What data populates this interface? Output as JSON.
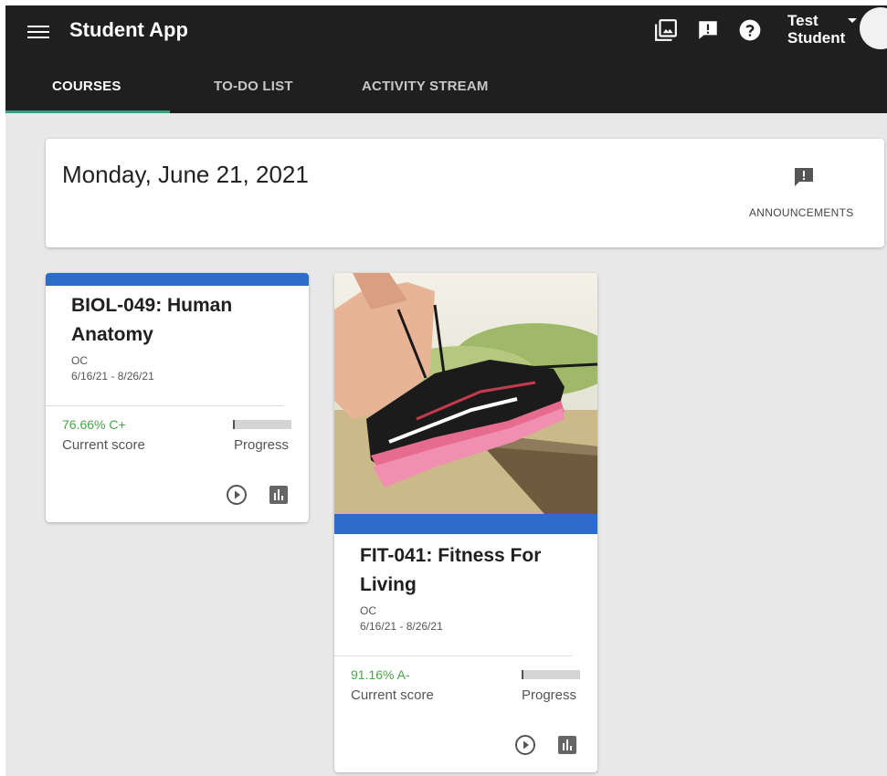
{
  "app": {
    "title": "Student App",
    "user_name_first": "Test",
    "user_name_last": "Student"
  },
  "header_icons": [
    "gallery-icon",
    "feedback-icon",
    "help-icon"
  ],
  "tabs": [
    {
      "label": "COURSES",
      "active": true
    },
    {
      "label": "TO-DO LIST",
      "active": false
    },
    {
      "label": "ACTIVITY STREAM",
      "active": false
    }
  ],
  "date_card": {
    "date": "Monday, June 21, 2021",
    "announcements_label": "ANNOUNCEMENTS"
  },
  "courses": [
    {
      "title_line1": "BIOL-049: Human",
      "title_line2": "Anatomy",
      "campus": "OC",
      "dates": "6/16/21 - 8/26/21",
      "score": "76.66% C+",
      "score_label": "Current score",
      "progress_label": "Progress",
      "progress": 0.03
    },
    {
      "title_line1": "FIT-041: Fitness For",
      "title_line2": "Living",
      "campus": "OC",
      "dates": "6/16/21 - 8/26/21",
      "score": "91.16% A-",
      "score_label": "Current score",
      "progress_label": "Progress",
      "progress": 0.03
    }
  ],
  "colors": {
    "card_accent": "#2d6dc9",
    "score_green": "#4aa54a",
    "tab_underline": "#3a9f86",
    "topbar": "#1f1f1f"
  }
}
